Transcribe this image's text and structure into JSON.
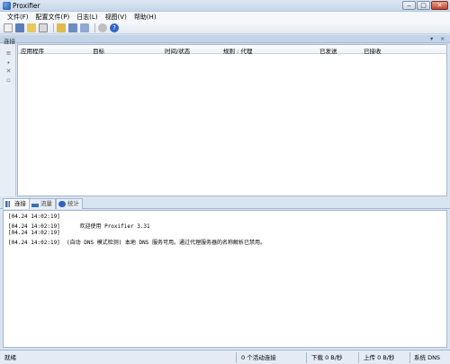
{
  "window": {
    "title": "Proxifier"
  },
  "menu": [
    "文件(F)",
    "配置文件(P)",
    "日志(L)",
    "视图(V)",
    "帮助(H)"
  ],
  "toolbar_icons": [
    "new-profile-icon",
    "save-icon",
    "open-icon",
    "print-icon",
    "proxy-servers-icon",
    "rules-icon",
    "name-resolution-icon",
    "advanced-icon",
    "help-icon"
  ],
  "connections_pane": {
    "title": "连接",
    "columns": [
      "应用程序",
      "目标",
      "时间/状态",
      "规则 : 代理",
      "已发送",
      "已接收"
    ]
  },
  "tabs": [
    {
      "label": "连接",
      "active": true
    },
    {
      "label": "流量",
      "active": false
    },
    {
      "label": "统计",
      "active": false
    }
  ],
  "log": [
    "[04.24 14:02:19]",
    "[04.24 14:02:19]      欢迎使用 Proxifier 3.31",
    "[04.24 14:02:19]",
    "[04.24 14:02:19]  (自动 DNS 模式检测) 本地 DNS 服务可用。通过代理服务器的名称解析已禁用。"
  ],
  "status": {
    "ready": "就绪",
    "active_connections": "0 个活动连接",
    "download": "下载 0 B/秒",
    "upload": "上传 0 B/秒",
    "dns": "系统 DNS"
  }
}
